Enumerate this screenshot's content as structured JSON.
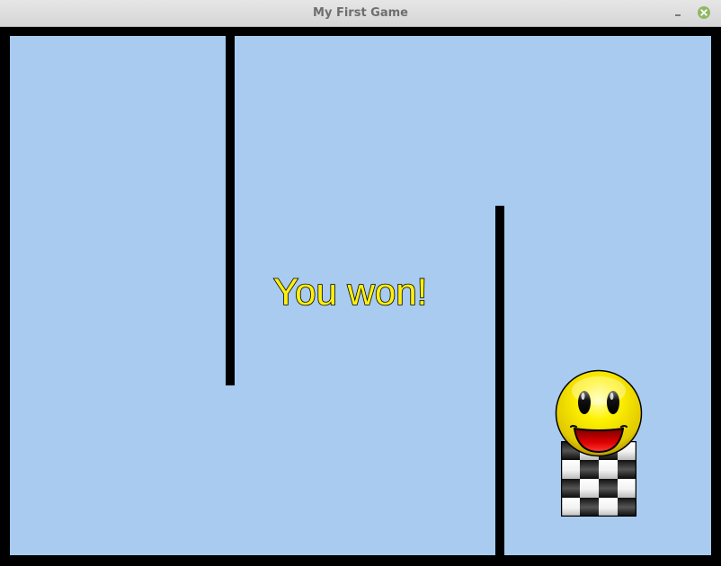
{
  "window": {
    "title": "My First Game",
    "minimize_glyph": "–",
    "close_icon": "close-icon"
  },
  "game": {
    "message": "You won!",
    "colors": {
      "background": "#a8cbef",
      "wall": "#000000",
      "message_fill": "#ffef10",
      "message_outline": "#000000",
      "player_face": "#f5e000",
      "player_mouth": "#cc0000"
    },
    "sprites": {
      "player": "smiley-face-icon",
      "goal": "checkered-flag-icon"
    }
  }
}
